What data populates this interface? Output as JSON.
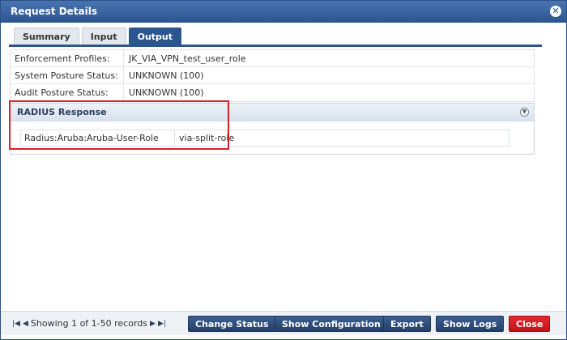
{
  "window": {
    "title": "Request Details"
  },
  "tabs": [
    {
      "label": "Summary"
    },
    {
      "label": "Input"
    },
    {
      "label": "Output"
    }
  ],
  "properties": [
    {
      "label": "Enforcement Profiles:",
      "value": "JK_VIA_VPN_test_user_role"
    },
    {
      "label": "System Posture Status:",
      "value": "UNKNOWN (100)"
    },
    {
      "label": "Audit Posture Status:",
      "value": "UNKNOWN (100)"
    }
  ],
  "radius": {
    "title": "RADIUS Response",
    "label": "Radius:Aruba:Aruba-User-Role",
    "value": "via-split-role"
  },
  "footer": {
    "pager_text": "Showing 1 of 1-50 records",
    "buttons": {
      "change_status": "Change Status",
      "show_configuration": "Show Configuration",
      "export": "Export",
      "show_logs": "Show Logs",
      "close": "Close"
    }
  },
  "colors": {
    "accent": "#2b558f",
    "danger": "#d8202a"
  },
  "icons": {
    "close": "close-icon",
    "collapse": "collapse-icon"
  }
}
